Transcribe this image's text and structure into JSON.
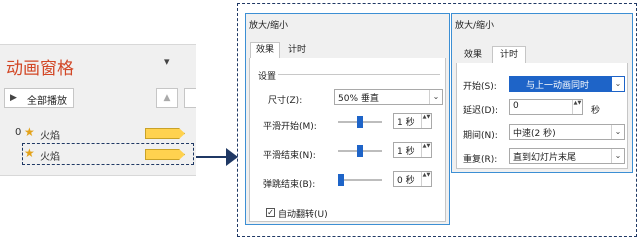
{
  "left_pane": {
    "title": "动画窗格",
    "close_glyph": "▾",
    "play_all_label": "全部播放",
    "play_icon": "play-triangle-icon",
    "up_glyph": "▲",
    "items": [
      {
        "index": "0",
        "star_icon": "star-icon",
        "label": "火焰"
      },
      {
        "index": "",
        "star_icon": "star-icon",
        "label": "火焰"
      }
    ]
  },
  "effect_dialog": {
    "title": "放大/缩小",
    "tabs": [
      "效果",
      "计时"
    ],
    "active_tab": "效果",
    "group_label": "设置",
    "size_label": "尺寸(Z):",
    "size_value": "50% 垂直",
    "smooth_start_label": "平滑开始(M):",
    "smooth_start_value": "1 秒",
    "smooth_end_label": "平滑结束(N):",
    "smooth_end_value": "1 秒",
    "bounce_end_label": "弹跳结束(B):",
    "bounce_end_value": "0 秒",
    "autoreverse_label": "自动翻转(U)",
    "autoreverse_checked": true,
    "check_glyph": "✓"
  },
  "timing_dialog": {
    "title": "放大/缩小",
    "tabs": [
      "效果",
      "计时"
    ],
    "active_tab": "计时",
    "start_label": "开始(S):",
    "start_value": "与上一动画同时",
    "delay_label": "延迟(D):",
    "delay_value": "0",
    "delay_unit": "秒",
    "duration_label": "期间(N):",
    "duration_value": "中速(2 秒)",
    "repeat_label": "重复(R):",
    "repeat_value": "直到幻灯片末尾"
  },
  "glyphs": {
    "chevron": "⌄",
    "spin": "▲▼",
    "star": "★"
  },
  "colors": {
    "title_red": "#d24726",
    "accent_blue": "#1e64c8",
    "timeline_yellow": "#ffd24f",
    "callout_navy": "#1f3864"
  }
}
